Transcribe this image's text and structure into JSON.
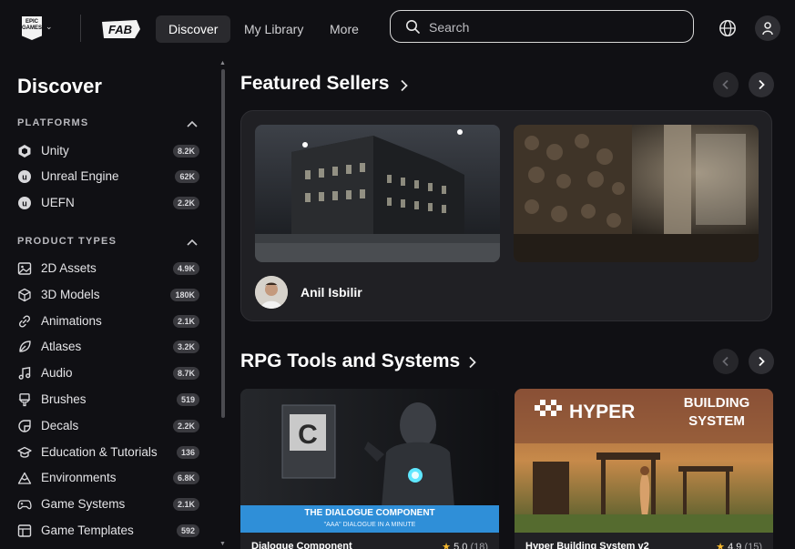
{
  "header": {
    "epic_logo_text": "EPIC GAMES",
    "fab_logo_text": "FAB",
    "nav": [
      {
        "label": "Discover",
        "active": true
      },
      {
        "label": "My Library",
        "active": false
      },
      {
        "label": "More",
        "active": false
      }
    ],
    "search_placeholder": "Search",
    "icons": {
      "search": "search-icon",
      "globe": "globe-icon",
      "user": "user-icon"
    }
  },
  "sidebar": {
    "title": "Discover",
    "platforms": {
      "heading": "PLATFORMS",
      "items": [
        {
          "label": "Unity",
          "count": "8.2K",
          "icon": "unity-icon"
        },
        {
          "label": "Unreal Engine",
          "count": "62K",
          "icon": "unreal-icon"
        },
        {
          "label": "UEFN",
          "count": "2.2K",
          "icon": "uefn-icon"
        }
      ]
    },
    "product_types": {
      "heading": "PRODUCT TYPES",
      "items": [
        {
          "label": "2D Assets",
          "count": "4.9K",
          "icon": "image-icon"
        },
        {
          "label": "3D Models",
          "count": "180K",
          "icon": "cube-icon"
        },
        {
          "label": "Animations",
          "count": "2.1K",
          "icon": "link-icon"
        },
        {
          "label": "Atlases",
          "count": "3.2K",
          "icon": "leaf-icon"
        },
        {
          "label": "Audio",
          "count": "8.7K",
          "icon": "music-icon"
        },
        {
          "label": "Brushes",
          "count": "519",
          "icon": "brush-icon"
        },
        {
          "label": "Decals",
          "count": "2.2K",
          "icon": "decal-icon"
        },
        {
          "label": "Education & Tutorials",
          "count": "136",
          "icon": "graduation-cap-icon"
        },
        {
          "label": "Environments",
          "count": "6.8K",
          "icon": "mountain-icon"
        },
        {
          "label": "Game Systems",
          "count": "2.1K",
          "icon": "gamepad-icon"
        },
        {
          "label": "Game Templates",
          "count": "592",
          "icon": "template-icon"
        }
      ]
    }
  },
  "featured_sellers": {
    "title": "Featured Sellers",
    "seller_name": "Anil Isbilir"
  },
  "rpg_section": {
    "title": "RPG Tools and Systems",
    "products": [
      {
        "name": "Dialogue Component",
        "rating": "5.0",
        "reviews": "(18)",
        "banner_line1": "THE DIALOGUE COMPONENT",
        "banner_line2": "\"AAA\" DIALOGUE IN A MINUTE"
      },
      {
        "name": "Hyper Building System v2",
        "rating": "4.9",
        "reviews": "(15)",
        "logo_text": "HYPER",
        "overlay_line1": "BUILDING",
        "overlay_line2": "SYSTEM"
      }
    ]
  },
  "colors": {
    "background": "#101014",
    "card": "#202024",
    "badge": "#3a3a3f",
    "star": "#f5b82e",
    "dialogue_banner": "#2f8fd8"
  }
}
